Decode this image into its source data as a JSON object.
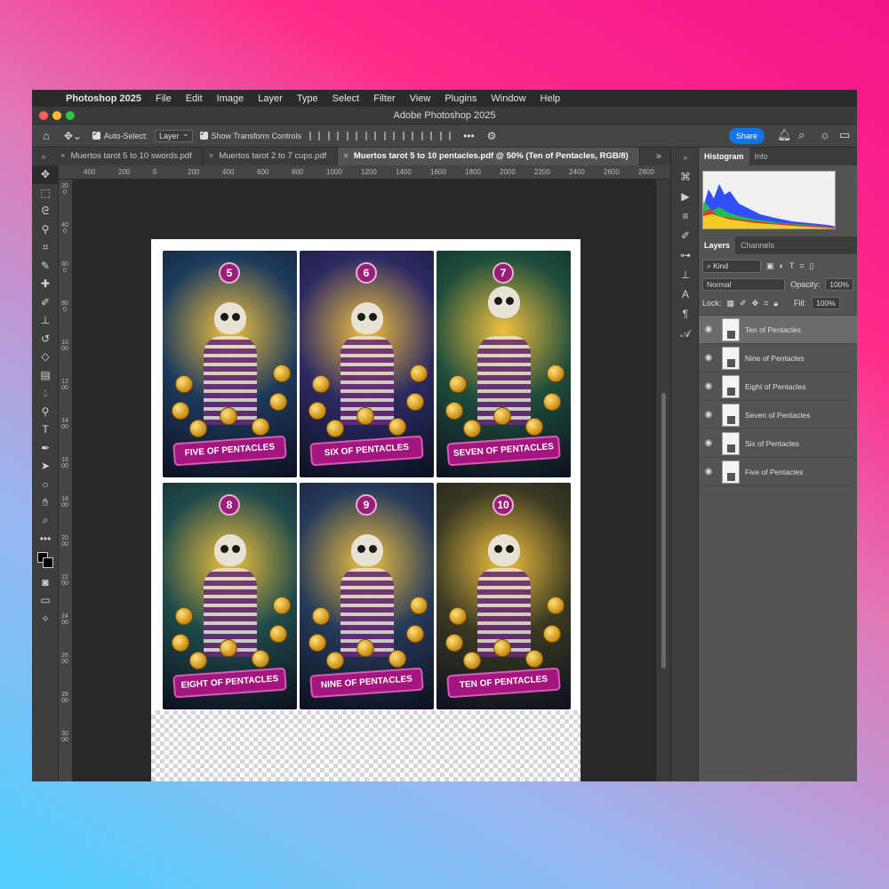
{
  "menubar": {
    "app_name": "Photoshop 2025",
    "items": [
      "File",
      "Edit",
      "Image",
      "Layer",
      "Type",
      "Select",
      "Filter",
      "View",
      "Plugins",
      "Window",
      "Help"
    ]
  },
  "window": {
    "title": "Adobe Photoshop 2025"
  },
  "options": {
    "auto_select_label": "Auto-Select:",
    "auto_select_value": "Layer",
    "transform_label": "Show Transform Controls",
    "share_label": "Share"
  },
  "tabs": [
    {
      "label": "Muertos tarot 5 to 10 swords.pdf",
      "active": false
    },
    {
      "label": "Muertos tarot 2 to 7 cups.pdf",
      "active": false
    },
    {
      "label": "Muertos  tarot 5 to 10 pentacles.pdf @ 50% (Ten of Pentacles, RGB/8)",
      "active": true
    }
  ],
  "ruler_top": [
    "400",
    "200",
    "0",
    "200",
    "400",
    "600",
    "800",
    "1000",
    "1200",
    "1400",
    "1600",
    "1800",
    "2000",
    "2200",
    "2400",
    "2600",
    "2800"
  ],
  "ruler_left": [
    "2 0 0",
    "4 0 0",
    "6 0 0",
    "8 0 0",
    "1 0 0 0",
    "1 2 0 0",
    "1 4 0 0",
    "1 6 0 0",
    "1 8 0 0",
    "2 0 0 0",
    "2 2 0 0",
    "2 4 0 0",
    "2 6 0 0",
    "2 8 0 0",
    "3 0 0 0"
  ],
  "cards": [
    {
      "number": "5",
      "title": "FIVE OF PENTACLES",
      "bg": "#1d3a5c"
    },
    {
      "number": "6",
      "title": "SIX OF PENTACLES",
      "bg": "#2d2a63"
    },
    {
      "number": "7",
      "title": "SEVEN OF PENTACLES",
      "bg": "#1e4d3b"
    },
    {
      "number": "8",
      "title": "EIGHT OF PENTACLES",
      "bg": "#1f4a4a"
    },
    {
      "number": "9",
      "title": "NINE OF PENTACLES",
      "bg": "#263a5a"
    },
    {
      "number": "10",
      "title": "TEN OF PENTACLES",
      "bg": "#3a3a22"
    }
  ],
  "panel": {
    "histogram_tab": "Histogram",
    "info_tab": "Info",
    "layers_tab": "Layers",
    "channels_tab": "Channels",
    "kind_label": "Kind",
    "blend_mode": "Normal",
    "opacity_label": "Opacity:",
    "opacity_value": "100%",
    "lock_label": "Lock:",
    "fill_label": "Fill:",
    "fill_value": "100%"
  },
  "layers": [
    {
      "name": "Ten of Pentacles",
      "selected": true
    },
    {
      "name": "Nine of Pentacles",
      "selected": false
    },
    {
      "name": "Eight of Pentacles",
      "selected": false
    },
    {
      "name": "Seven of Pentacles",
      "selected": false
    },
    {
      "name": "Six of Pentacles",
      "selected": false
    },
    {
      "name": "Five of Pentacles",
      "selected": false
    }
  ],
  "colors": {
    "accent": "#1473e6",
    "banner": "#a4167f"
  }
}
